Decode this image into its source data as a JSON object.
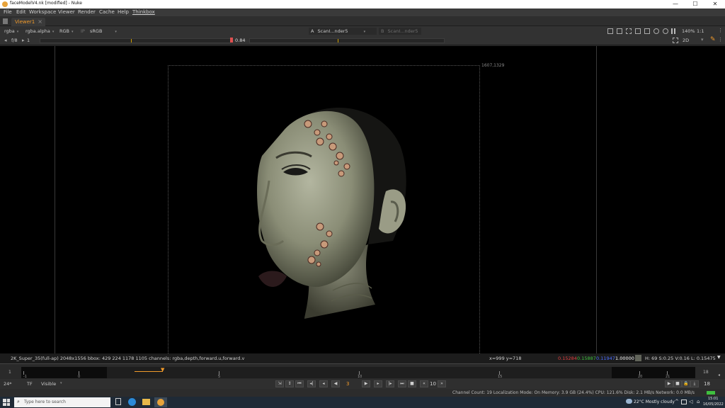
{
  "window": {
    "title": "faceModelV4.nk [modified] - Nuke",
    "controls": [
      "—",
      "☐",
      "✕"
    ]
  },
  "menu": [
    "File",
    "Edit",
    "Workspace",
    "Viewer",
    "Render",
    "Cache",
    "Help",
    "Thinkbox"
  ],
  "tab": {
    "label": "Viewer1",
    "close": "×"
  },
  "toolbar1": {
    "channels": "rgba",
    "alpha": "rgba.alpha",
    "display": "RGB",
    "ip": "IP",
    "lut": "sRGB",
    "input_a_letter": "A",
    "input_a": "ScanI...nder5",
    "input_b_letter": "B",
    "input_b": "ScanI...nder5",
    "zoom": "140%",
    "ratio": "1:1"
  },
  "toolbar2": {
    "fstop": "f/8",
    "frame_inc": "1",
    "gain": "0.84",
    "mode": "2D"
  },
  "viewer": {
    "corner_label": "1607,1329"
  },
  "infobar": {
    "format": "2K_Super_35(full-ap) 2048x1556  bbox: 429 224 1178 1105 channels: rgba,depth,forward.u,forward.v",
    "coords": "x=999 y=718",
    "r": "0.15284",
    "g": "0.15887",
    "b": "0.11947",
    "a": "1.00000",
    "hsvl": "H: 69 S:0.25 V:0.16  L: 0.15475"
  },
  "timeline": {
    "start": "1",
    "end": "18",
    "ticks": [
      "-1",
      "0",
      "5",
      "10",
      "15",
      "20",
      "21"
    ],
    "current": "3"
  },
  "playbar": {
    "fps": "24*",
    "tf": "TF",
    "visible": "Visible",
    "frame": "3",
    "step": "10",
    "end": "18"
  },
  "status": {
    "text": "Channel Count: 19  Localization Mode: On  Memory: 3.9 GB (24.4%)  CPU: 121.6%  Disk: 2.1 MB/s  Network: 0.0 MB/s"
  },
  "taskbar": {
    "search": "Type here to search",
    "weather": "22°C  Mostly cloudy",
    "time": "15:01",
    "date": "16/05/2022"
  },
  "colors": {
    "accent": "#f09a2b",
    "red": "#e04040",
    "green": "#3fbf3f",
    "blue": "#4a6cff"
  }
}
